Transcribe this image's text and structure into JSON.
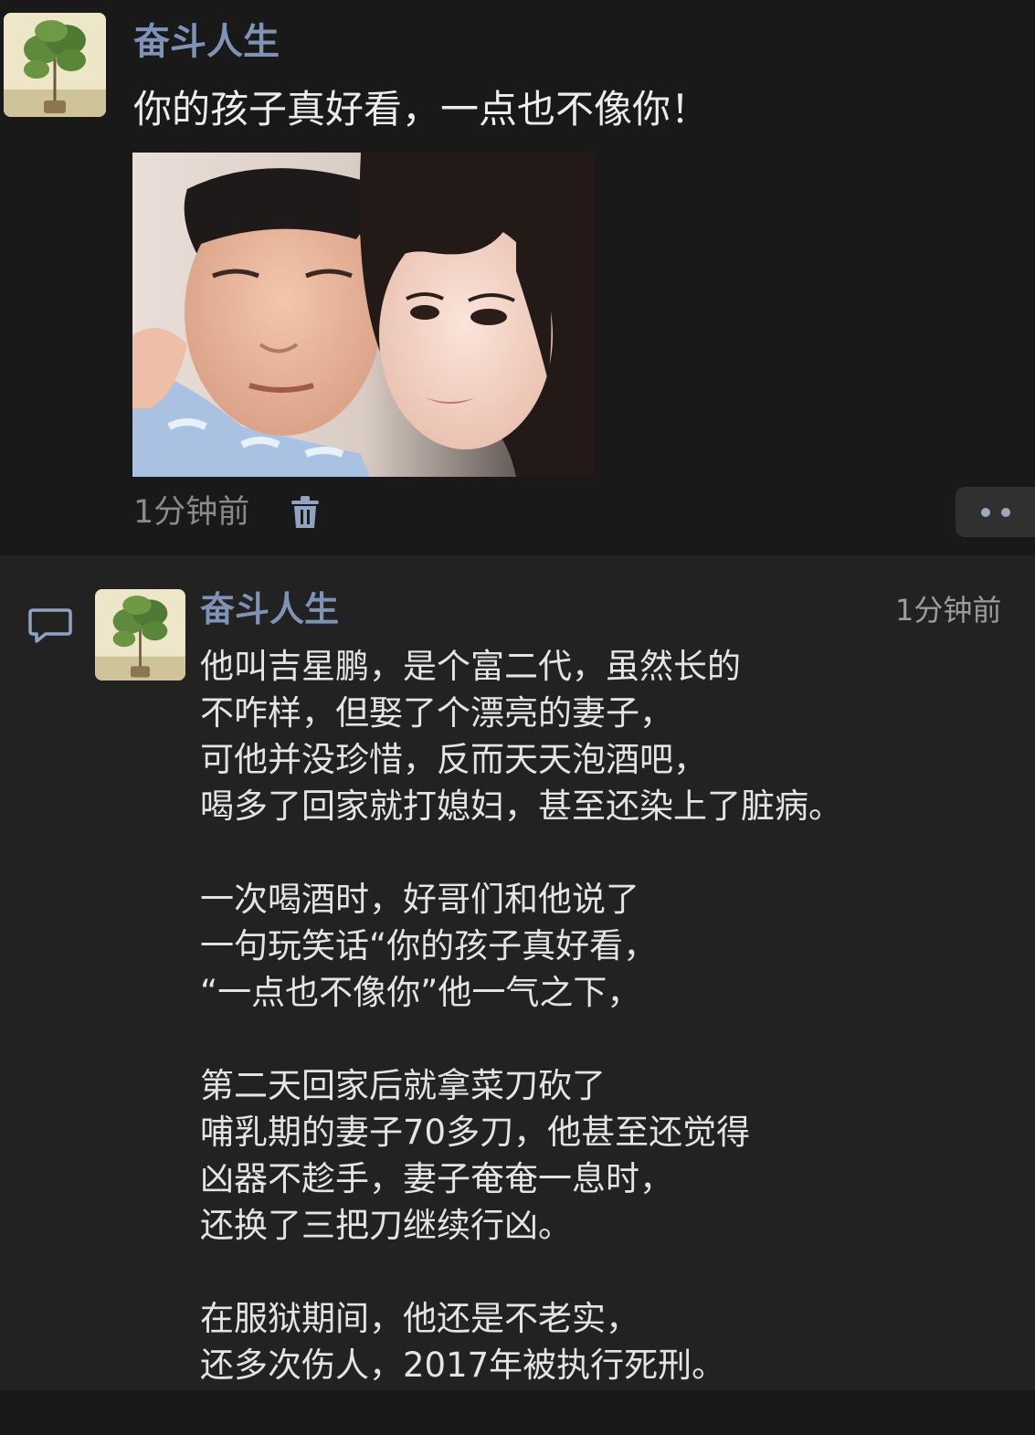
{
  "post": {
    "author": "奋斗人生",
    "text": "你的孩子真好看，一点也不像你！",
    "timestamp": "1分钟前",
    "icons": {
      "avatar": "plant-avatar",
      "delete": "trash-icon",
      "more": "more-dots-icon"
    }
  },
  "comment": {
    "author": "奋斗人生",
    "timestamp": "1分钟前",
    "icons": {
      "comment": "comment-bubble-icon",
      "avatar": "plant-avatar"
    },
    "paragraphs": [
      {
        "lines": [
          "他叫吉星鹏，是个富二代，虽然长的",
          "不咋样，但娶了个漂亮的妻子，",
          "可他并没珍惜，反而天天泡酒吧，",
          "喝多了回家就打媳妇，甚至还染上了脏病。"
        ]
      },
      {
        "lines": [
          "一次喝酒时，好哥们和他说了",
          "一句玩笑话“你的孩子真好看，",
          "“一点也不像你”他一气之下，"
        ]
      },
      {
        "lines": [
          "第二天回家后就拿菜刀砍了",
          "哺乳期的妻子70多刀，他甚至还觉得",
          "凶器不趁手，妻子奄奄一息时，",
          "还换了三把刀继续行凶。"
        ]
      },
      {
        "lines": [
          "在服狱期间，他还是不老实，",
          "还多次伤人，2017年被执行死刑。"
        ]
      }
    ]
  },
  "colors": {
    "background": "#191919",
    "comment_background": "#222222",
    "author_name": "#7e93b5",
    "body_text": "#e4e4e4",
    "timestamp": "#8a8a8a"
  }
}
